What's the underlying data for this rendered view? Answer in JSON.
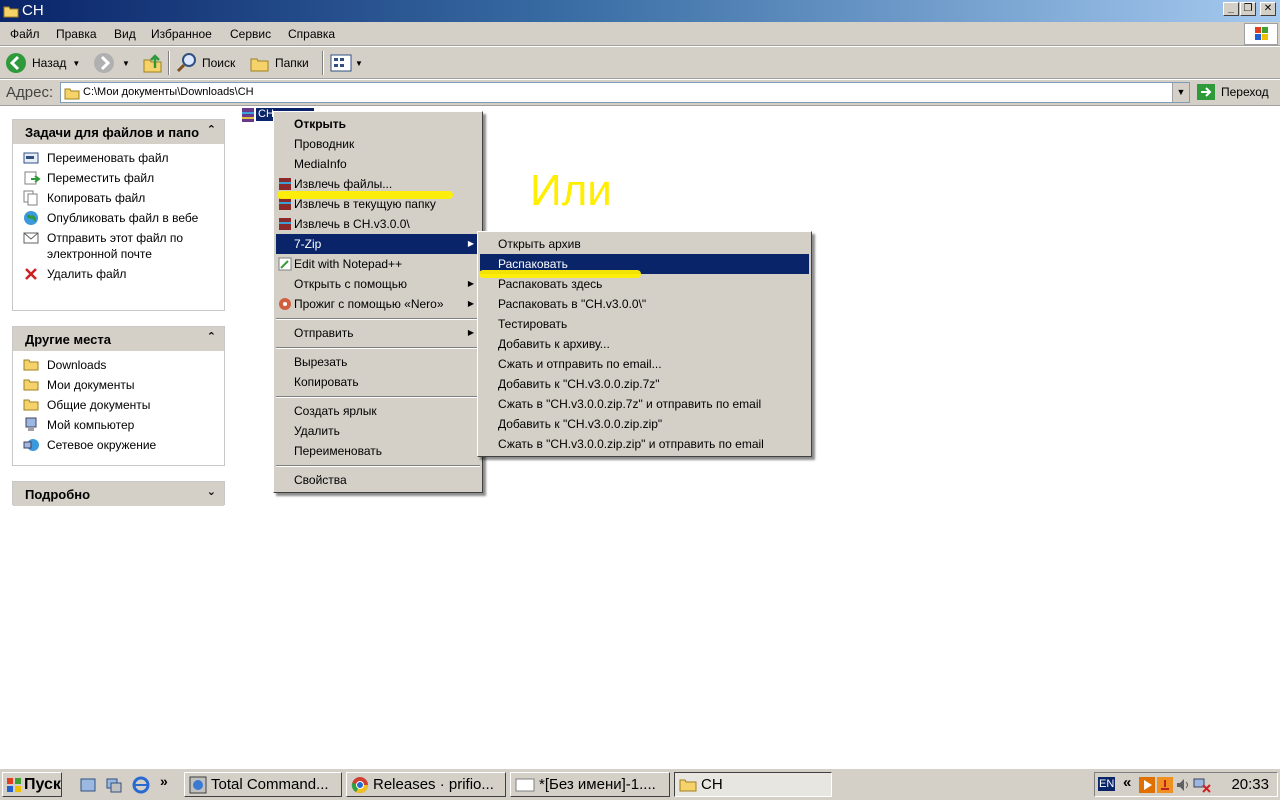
{
  "window": {
    "title": "CH"
  },
  "menubar": [
    "Файл",
    "Правка",
    "Вид",
    "Избранное",
    "Сервис",
    "Справка"
  ],
  "toolbar": {
    "back": "Назад",
    "search": "Поиск",
    "folders": "Папки"
  },
  "address": {
    "label": "Адрес:",
    "path": "C:\\Мои документы\\Downloads\\CH",
    "go": "Переход"
  },
  "tasks_panel": {
    "title": "Задачи для файлов и папок",
    "items": [
      "Переименовать файл",
      "Переместить файл",
      "Копировать файл",
      "Опубликовать файл в вебе",
      "Отправить этот файл по электронной почте",
      "Удалить файл"
    ]
  },
  "places_panel": {
    "title": "Другие места",
    "items": [
      "Downloads",
      "Мои документы",
      "Общие документы",
      "Мой компьютер",
      "Сетевое окружение"
    ]
  },
  "details_panel": {
    "title": "Подробно"
  },
  "file": {
    "label": "CH"
  },
  "context_menu": [
    "Открыть",
    "Проводник",
    "MediaInfo",
    "Извлечь файлы...",
    "Извлечь в текущую папку",
    "Извлечь в CH.v3.0.0\\",
    "7-Zip",
    "Edit with Notepad++",
    "Открыть с помощью",
    "Прожиг с помощью «Nero»",
    "Отправить",
    "Вырезать",
    "Копировать",
    "Создать ярлык",
    "Удалить",
    "Переименовать",
    "Свойства"
  ],
  "submenu_7zip": [
    "Открыть архив",
    "Распаковать",
    "Распаковать здесь",
    "Распаковать в \"CH.v3.0.0\\\"",
    "Тестировать",
    "Добавить к архиву...",
    "Сжать и отправить по email...",
    "Добавить к \"CH.v3.0.0.zip.7z\"",
    "Сжать в \"CH.v3.0.0.zip.7z\" и отправить по email",
    "Добавить к \"CH.v3.0.0.zip.zip\"",
    "Сжать в \"CH.v3.0.0.zip.zip\" и отправить по email"
  ],
  "annotation": "Или",
  "taskbar": {
    "start": "Пуск",
    "buttons": [
      "Total Command...",
      "Releases · prifio...",
      "*[Без имени]-1....",
      "CH"
    ],
    "lang": "EN",
    "clock": "20:33"
  }
}
